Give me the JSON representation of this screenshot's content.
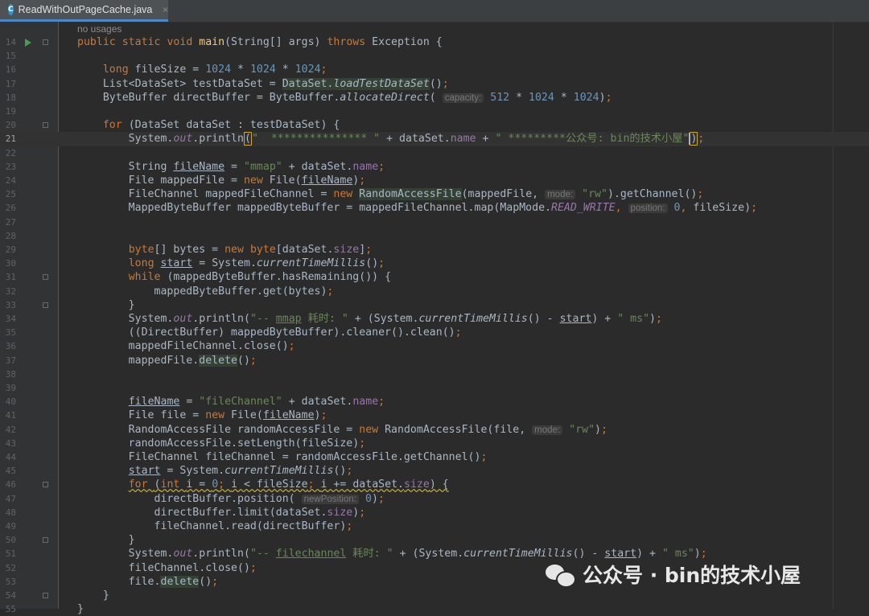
{
  "tab": {
    "icon_letter": "C",
    "title": "ReadWithOutPageCache.java",
    "close": "×"
  },
  "hint": "no usages",
  "lines": [
    {
      "n": 14,
      "has_run": true,
      "fold": true,
      "tokens": [
        {
          "t": "public ",
          "c": "kw"
        },
        {
          "t": "static ",
          "c": "kw"
        },
        {
          "t": "void ",
          "c": "kw"
        },
        {
          "t": "main",
          "c": "fn"
        },
        {
          "t": "(String[] args) "
        },
        {
          "t": "throws ",
          "c": "kw"
        },
        {
          "t": "Exception {"
        }
      ]
    },
    {
      "n": 15,
      "tokens": []
    },
    {
      "n": 16,
      "tokens": [
        {
          "t": "    "
        },
        {
          "t": "long ",
          "c": "kw"
        },
        {
          "t": "fileSize = "
        },
        {
          "t": "1024",
          "c": "num"
        },
        {
          "t": " * "
        },
        {
          "t": "1024",
          "c": "num"
        },
        {
          "t": " * "
        },
        {
          "t": "1024",
          "c": "num"
        },
        {
          "t": ";",
          "c": "kw"
        }
      ]
    },
    {
      "n": 17,
      "tokens": [
        {
          "t": "    List<DataSet> testDataSet = "
        },
        {
          "t": "DataSet.",
          "c": "hlbg"
        },
        {
          "t": "loadTestDataSet",
          "c": "hlbg smeth"
        },
        {
          "t": "()"
        },
        {
          "t": ";",
          "c": "kw"
        }
      ]
    },
    {
      "n": 18,
      "tokens": [
        {
          "t": "    ByteBuffer directBuffer = ByteBuffer."
        },
        {
          "t": "allocateDirect",
          "c": "smeth"
        },
        {
          "t": "( "
        },
        {
          "t": "capacity:",
          "c": "ph"
        },
        {
          "t": " "
        },
        {
          "t": "512",
          "c": "num"
        },
        {
          "t": " * "
        },
        {
          "t": "1024",
          "c": "num"
        },
        {
          "t": " * "
        },
        {
          "t": "1024",
          "c": "num"
        },
        {
          "t": ")"
        },
        {
          "t": ";",
          "c": "kw"
        }
      ]
    },
    {
      "n": 19,
      "tokens": []
    },
    {
      "n": 20,
      "fold": true,
      "tokens": [
        {
          "t": "    "
        },
        {
          "t": "for ",
          "c": "kw"
        },
        {
          "t": "(DataSet dataSet : testDataSet) {"
        }
      ]
    },
    {
      "n": 21,
      "current": true,
      "tokens": [
        {
          "t": "        System."
        },
        {
          "t": "out",
          "c": "sfld"
        },
        {
          "t": ".println"
        },
        {
          "t": "(",
          "c": "brace"
        },
        {
          "t": "\"  *************** \"",
          "c": "str"
        },
        {
          "t": " + dataSet."
        },
        {
          "t": "name",
          "c": "fld"
        },
        {
          "t": " + "
        },
        {
          "t": "\" *********公众号: bin的技术小屋\"",
          "c": "str"
        },
        {
          "t": "CARET"
        },
        {
          "t": ")",
          "c": "brace"
        },
        {
          "t": ";",
          "c": "kw"
        }
      ]
    },
    {
      "n": 22,
      "tokens": []
    },
    {
      "n": 23,
      "tokens": [
        {
          "t": "        String "
        },
        {
          "t": "fileName",
          "c": "ul"
        },
        {
          "t": " = "
        },
        {
          "t": "\"mmap\"",
          "c": "str"
        },
        {
          "t": " + dataSet."
        },
        {
          "t": "name",
          "c": "fld"
        },
        {
          "t": ";",
          "c": "kw"
        }
      ]
    },
    {
      "n": 24,
      "tokens": [
        {
          "t": "        File mappedFile = "
        },
        {
          "t": "new ",
          "c": "kw"
        },
        {
          "t": "File("
        },
        {
          "t": "fileName",
          "c": "ul"
        },
        {
          "t": ")"
        },
        {
          "t": ";",
          "c": "kw"
        }
      ]
    },
    {
      "n": 25,
      "tokens": [
        {
          "t": "        FileChannel mappedFileChannel = "
        },
        {
          "t": "new ",
          "c": "kw"
        },
        {
          "t": "RandomAccessFile",
          "c": "hlbg"
        },
        {
          "t": "(mappedFile, "
        },
        {
          "t": "mode:",
          "c": "ph"
        },
        {
          "t": " "
        },
        {
          "t": "\"rw\"",
          "c": "str"
        },
        {
          "t": ").getChannel()"
        },
        {
          "t": ";",
          "c": "kw"
        }
      ]
    },
    {
      "n": 26,
      "tokens": [
        {
          "t": "        MappedByteBuffer mappedByteBuffer = mappedFileChannel.map(MapMode."
        },
        {
          "t": "READ_WRITE",
          "c": "sfld"
        },
        {
          "t": ", ",
          "c": "kw"
        },
        {
          "t": "position:",
          "c": "ph"
        },
        {
          "t": " "
        },
        {
          "t": "0",
          "c": "num"
        },
        {
          "t": ", ",
          "c": "kw"
        },
        {
          "t": "fileSize)"
        },
        {
          "t": ";",
          "c": "kw"
        }
      ]
    },
    {
      "n": 27,
      "tokens": []
    },
    {
      "n": 28,
      "tokens": []
    },
    {
      "n": 29,
      "tokens": [
        {
          "t": "        "
        },
        {
          "t": "byte",
          "c": "kw"
        },
        {
          "t": "[] bytes = "
        },
        {
          "t": "new ",
          "c": "kw"
        },
        {
          "t": "byte",
          "c": "kw"
        },
        {
          "t": "[dataSet."
        },
        {
          "t": "size",
          "c": "fld"
        },
        {
          "t": "]"
        },
        {
          "t": ";",
          "c": "kw"
        }
      ]
    },
    {
      "n": 30,
      "tokens": [
        {
          "t": "        "
        },
        {
          "t": "long ",
          "c": "kw"
        },
        {
          "t": "start",
          "c": "ul"
        },
        {
          "t": " = System."
        },
        {
          "t": "currentTimeMillis",
          "c": "smeth"
        },
        {
          "t": "()"
        },
        {
          "t": ";",
          "c": "kw"
        }
      ]
    },
    {
      "n": 31,
      "fold": true,
      "tokens": [
        {
          "t": "        "
        },
        {
          "t": "while ",
          "c": "kw"
        },
        {
          "t": "(mappedByteBuffer.hasRemaining()) {"
        }
      ]
    },
    {
      "n": 32,
      "tokens": [
        {
          "t": "            mappedByteBuffer.get(bytes)"
        },
        {
          "t": ";",
          "c": "kw"
        }
      ]
    },
    {
      "n": 33,
      "fold": true,
      "tokens": [
        {
          "t": "        }"
        }
      ]
    },
    {
      "n": 34,
      "tokens": [
        {
          "t": "        System."
        },
        {
          "t": "out",
          "c": "sfld"
        },
        {
          "t": ".println("
        },
        {
          "t": "\"-- ",
          "c": "str"
        },
        {
          "t": "mmap",
          "c": "str ul"
        },
        {
          "t": " 耗时: \"",
          "c": "str"
        },
        {
          "t": " + (System."
        },
        {
          "t": "currentTimeMillis",
          "c": "smeth"
        },
        {
          "t": "() - "
        },
        {
          "t": "start",
          "c": "ul"
        },
        {
          "t": ") + "
        },
        {
          "t": "\" ms\"",
          "c": "str"
        },
        {
          "t": ")"
        },
        {
          "t": ";",
          "c": "kw"
        }
      ]
    },
    {
      "n": 35,
      "tokens": [
        {
          "t": "        ((DirectBuffer) mappedByteBuffer).cleaner().clean()"
        },
        {
          "t": ";",
          "c": "kw"
        }
      ]
    },
    {
      "n": 36,
      "tokens": [
        {
          "t": "        mappedFileChannel.close()"
        },
        {
          "t": ";",
          "c": "kw"
        }
      ]
    },
    {
      "n": 37,
      "tokens": [
        {
          "t": "        mappedFile."
        },
        {
          "t": "delete",
          "c": "hlbg"
        },
        {
          "t": "()"
        },
        {
          "t": ";",
          "c": "kw"
        }
      ]
    },
    {
      "n": 38,
      "tokens": []
    },
    {
      "n": 39,
      "tokens": []
    },
    {
      "n": 40,
      "tokens": [
        {
          "t": "        "
        },
        {
          "t": "fileName",
          "c": "ul"
        },
        {
          "t": " = "
        },
        {
          "t": "\"fileChannel\"",
          "c": "str"
        },
        {
          "t": " + dataSet."
        },
        {
          "t": "name",
          "c": "fld"
        },
        {
          "t": ";",
          "c": "kw"
        }
      ]
    },
    {
      "n": 41,
      "tokens": [
        {
          "t": "        File file = "
        },
        {
          "t": "new ",
          "c": "kw"
        },
        {
          "t": "File("
        },
        {
          "t": "fileName",
          "c": "ul"
        },
        {
          "t": ")"
        },
        {
          "t": ";",
          "c": "kw"
        }
      ]
    },
    {
      "n": 42,
      "tokens": [
        {
          "t": "        RandomAccessFile randomAccessFile = "
        },
        {
          "t": "new ",
          "c": "kw"
        },
        {
          "t": "RandomAccessFile(file, "
        },
        {
          "t": "mode:",
          "c": "ph"
        },
        {
          "t": " "
        },
        {
          "t": "\"rw\"",
          "c": "str"
        },
        {
          "t": ")"
        },
        {
          "t": ";",
          "c": "kw"
        }
      ]
    },
    {
      "n": 43,
      "tokens": [
        {
          "t": "        randomAccessFile.setLength(fileSize)"
        },
        {
          "t": ";",
          "c": "kw"
        }
      ]
    },
    {
      "n": 44,
      "tokens": [
        {
          "t": "        FileChannel fileChannel = randomAccessFile.getChannel()"
        },
        {
          "t": ";",
          "c": "kw"
        }
      ]
    },
    {
      "n": 45,
      "tokens": [
        {
          "t": "        "
        },
        {
          "t": "start",
          "c": "ul"
        },
        {
          "t": " = System."
        },
        {
          "t": "currentTimeMillis",
          "c": "smeth"
        },
        {
          "t": "()"
        },
        {
          "t": ";",
          "c": "kw"
        }
      ]
    },
    {
      "n": 46,
      "fold": true,
      "tokens": [
        {
          "t": "        "
        },
        {
          "t": "for ",
          "c": "kw warn"
        },
        {
          "t": "(",
          "c": "warn"
        },
        {
          "t": "int ",
          "c": "kw warn"
        },
        {
          "t": "i = ",
          "c": "warn"
        },
        {
          "t": "0",
          "c": "num warn"
        },
        {
          "t": "; ",
          "c": "kw warn"
        },
        {
          "t": "i < fileSize",
          "c": "warn"
        },
        {
          "t": "; ",
          "c": "kw warn"
        },
        {
          "t": "i += dataSet.",
          "c": "warn"
        },
        {
          "t": "size",
          "c": "fld warn"
        },
        {
          "t": ") {",
          "c": "warn"
        }
      ]
    },
    {
      "n": 47,
      "tokens": [
        {
          "t": "            directBuffer.position( "
        },
        {
          "t": "newPosition:",
          "c": "ph"
        },
        {
          "t": " "
        },
        {
          "t": "0",
          "c": "num"
        },
        {
          "t": ")"
        },
        {
          "t": ";",
          "c": "kw"
        }
      ]
    },
    {
      "n": 48,
      "tokens": [
        {
          "t": "            directBuffer.limit(dataSet."
        },
        {
          "t": "size",
          "c": "fld"
        },
        {
          "t": ")"
        },
        {
          "t": ";",
          "c": "kw"
        }
      ]
    },
    {
      "n": 49,
      "tokens": [
        {
          "t": "            fileChannel.read(directBuffer)"
        },
        {
          "t": ";",
          "c": "kw"
        }
      ]
    },
    {
      "n": 50,
      "fold": true,
      "tokens": [
        {
          "t": "        }"
        }
      ]
    },
    {
      "n": 51,
      "tokens": [
        {
          "t": "        System."
        },
        {
          "t": "out",
          "c": "sfld"
        },
        {
          "t": ".println("
        },
        {
          "t": "\"-- ",
          "c": "str"
        },
        {
          "t": "filechannel",
          "c": "str ul"
        },
        {
          "t": " 耗时: \"",
          "c": "str"
        },
        {
          "t": " + (System."
        },
        {
          "t": "currentTimeMillis",
          "c": "smeth"
        },
        {
          "t": "() - "
        },
        {
          "t": "start",
          "c": "ul"
        },
        {
          "t": ") + "
        },
        {
          "t": "\" ms\"",
          "c": "str"
        },
        {
          "t": ")"
        },
        {
          "t": ";",
          "c": "kw"
        }
      ]
    },
    {
      "n": 52,
      "tokens": [
        {
          "t": "        fileChannel.close()"
        },
        {
          "t": ";",
          "c": "kw"
        }
      ]
    },
    {
      "n": 53,
      "tokens": [
        {
          "t": "        file."
        },
        {
          "t": "delete",
          "c": "hlbg"
        },
        {
          "t": "()"
        },
        {
          "t": ";",
          "c": "kw"
        }
      ]
    },
    {
      "n": 54,
      "fold": true,
      "tokens": [
        {
          "t": "    }"
        }
      ]
    },
    {
      "n": 55,
      "tokens": [
        {
          "t": "}"
        }
      ]
    }
  ],
  "watermark": {
    "text": "公众号 · bin的技术小屋",
    "icon": "wechat-icon"
  },
  "colors": {
    "keyword": "#cc7832",
    "method": "#ffc66d",
    "number": "#6897bb",
    "string": "#6a8759",
    "field": "#9876aa",
    "text": "#a9b7c6",
    "background": "#2b2b2b"
  }
}
